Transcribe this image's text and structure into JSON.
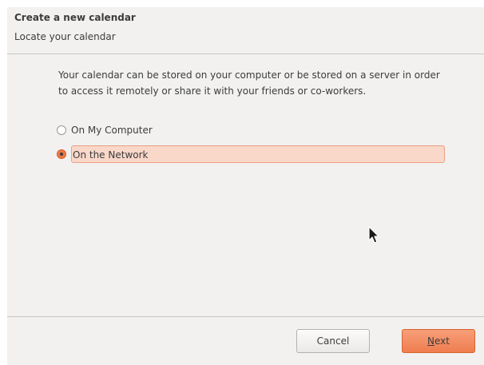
{
  "header": {
    "title": "Create a new calendar",
    "subtitle": "Locate your calendar"
  },
  "body": {
    "description": "Your calendar can be stored on your computer or be stored on a server in order to access it remotely or share it with your friends or co-workers.",
    "options": [
      {
        "label": "On My Computer",
        "selected": false
      },
      {
        "label": "On the Network",
        "selected": true
      }
    ]
  },
  "footer": {
    "cancel_label": "Cancel",
    "next_access_key": "N",
    "next_label_rest": "ext"
  },
  "colors": {
    "accent": "#f07746",
    "dialog_background": "#f2f1f0",
    "focus_highlight": "#f9d7c9"
  },
  "icons": {
    "pointer": "mouse-pointer-icon"
  }
}
